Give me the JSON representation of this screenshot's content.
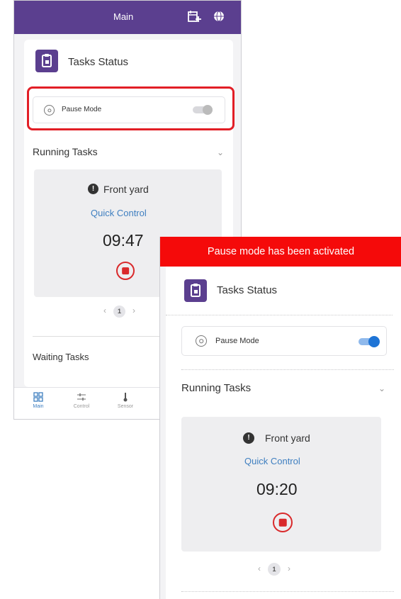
{
  "screen_back": {
    "header": {
      "title": "Main",
      "add_icon": "add-schedule-icon",
      "globe_icon": "globe-icon"
    },
    "panel_title": "Tasks Status",
    "pause_mode": {
      "label": "Pause Mode",
      "enabled": false
    },
    "running_section": "Running Tasks",
    "task": {
      "info_icon": "!",
      "name": "Front yard",
      "link": "Quick Control",
      "timer": "09:47"
    },
    "pager": {
      "prev": "‹",
      "page": "1",
      "next": "›"
    },
    "waiting_section": "Waiting Tasks",
    "bottom_nav": [
      {
        "label": "Main",
        "icon": "grid-icon",
        "active": true
      },
      {
        "label": "Control",
        "icon": "sliders-icon",
        "active": false
      },
      {
        "label": "Sensor",
        "icon": "thermometer-icon",
        "active": false
      }
    ]
  },
  "screen_front": {
    "banner": "Pause mode has been activated",
    "panel_title": "Tasks Status",
    "pause_mode": {
      "label": "Pause Mode",
      "enabled": true
    },
    "running_section": "Running Tasks",
    "task": {
      "info_icon": "!",
      "name": "Front yard",
      "link": "Quick Control",
      "timer": "09:20"
    },
    "pager": {
      "prev": "‹",
      "page": "1",
      "next": "›"
    }
  },
  "colors": {
    "header_purple": "#5b3f8f",
    "highlight_red": "#e21e26",
    "banner_red": "#f50a0a",
    "link_blue": "#3f7fc0",
    "stop_red": "#d9292b",
    "toggle_on": "#1e74d6"
  }
}
